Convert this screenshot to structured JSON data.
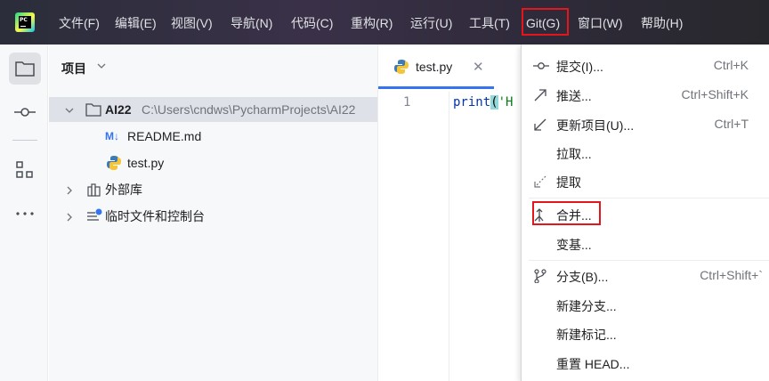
{
  "menubar": {
    "items": [
      {
        "label": "文件(F)"
      },
      {
        "label": "编辑(E)"
      },
      {
        "label": "视图(V)"
      },
      {
        "label": "导航(N)"
      },
      {
        "label": "代码(C)"
      },
      {
        "label": "重构(R)"
      },
      {
        "label": "运行(U)"
      },
      {
        "label": "工具(T)"
      },
      {
        "label": "Git(G)"
      },
      {
        "label": "窗口(W)"
      },
      {
        "label": "帮助(H)"
      }
    ],
    "highlight_color": "#e4161b",
    "logo_text": "PC"
  },
  "toolstrip": {
    "icons": [
      "folder-icon",
      "commit-icon",
      "structure-icon",
      "more-icon"
    ]
  },
  "project": {
    "title": "项目",
    "root": {
      "name": "AI22",
      "path": "C:\\Users\\cndws\\PycharmProjects\\AI22"
    },
    "files": [
      {
        "name": "README.md"
      },
      {
        "name": "test.py"
      }
    ],
    "nodes": [
      {
        "name": "外部库"
      },
      {
        "name": "临时文件和控制台"
      }
    ]
  },
  "editor": {
    "tab_label": "test.py",
    "line_number": "1",
    "code": {
      "keyword": "print",
      "open_paren": "(",
      "string": "'H"
    },
    "accent_color": "#3574f0"
  },
  "git_menu": {
    "items": [
      {
        "label": "提交(I)...",
        "shortcut": "Ctrl+K"
      },
      {
        "label": "推送...",
        "shortcut": "Ctrl+Shift+K"
      },
      {
        "label": "更新项目(U)...",
        "shortcut": "Ctrl+T"
      },
      {
        "label": "拉取...",
        "shortcut": ""
      },
      {
        "label": "提取",
        "shortcut": ""
      },
      {
        "label": "合并...",
        "shortcut": ""
      },
      {
        "label": "变基...",
        "shortcut": ""
      },
      {
        "label": "分支(B)...",
        "shortcut": "Ctrl+Shift+`"
      },
      {
        "label": "新建分支...",
        "shortcut": ""
      },
      {
        "label": "新建标记...",
        "shortcut": ""
      },
      {
        "label": "重置 HEAD...",
        "shortcut": ""
      }
    ]
  }
}
